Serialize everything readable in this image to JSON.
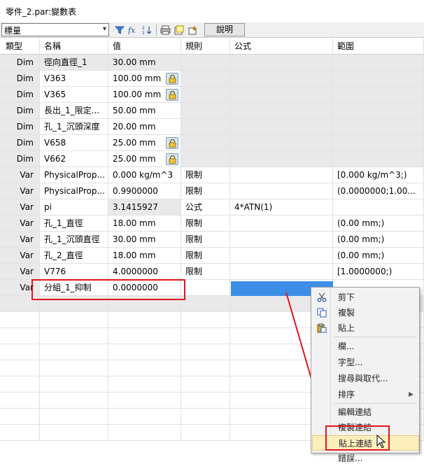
{
  "window": {
    "title": "零件_2.par:變數表"
  },
  "toolbar": {
    "filter_value": "標量",
    "help_label": "說明",
    "icons": [
      "filter-icon",
      "fx-icon",
      "sort-icon",
      "print-icon",
      "export-icon",
      "import-icon"
    ]
  },
  "table": {
    "headers": {
      "type": "類型",
      "name": "名稱",
      "value": "值",
      "rule": "規則",
      "formula": "公式",
      "range": "範圍"
    },
    "rows": [
      {
        "type": "Dim",
        "name": "徑向直徑_1",
        "value": "30.00 mm",
        "rule": "",
        "formula": "",
        "range": "",
        "lock": false
      },
      {
        "type": "Dim",
        "name": "V363",
        "value": "100.00 mm",
        "rule": "",
        "formula": "",
        "range": "",
        "lock": true
      },
      {
        "type": "Dim",
        "name": "V365",
        "value": "100.00 mm",
        "rule": "",
        "formula": "",
        "range": "",
        "lock": true
      },
      {
        "type": "Dim",
        "name": "長出_1_限定...",
        "value": "50.00 mm",
        "rule": "",
        "formula": "",
        "range": "",
        "lock": false
      },
      {
        "type": "Dim",
        "name": "孔_1_沉頭深度",
        "value": "20.00 mm",
        "rule": "",
        "formula": "",
        "range": "",
        "lock": false
      },
      {
        "type": "Dim",
        "name": "V658",
        "value": "25.00 mm",
        "rule": "",
        "formula": "",
        "range": "",
        "lock": true
      },
      {
        "type": "Dim",
        "name": "V662",
        "value": "25.00 mm",
        "rule": "",
        "formula": "",
        "range": "",
        "lock": true
      },
      {
        "type": "Var",
        "name": "PhysicalProp...",
        "value": "0.000 kg/m^3",
        "rule": "限制",
        "formula": "",
        "range": "[0.000 kg/m^3;)",
        "lock": false
      },
      {
        "type": "Var",
        "name": "PhysicalProp...",
        "value": "0.9900000",
        "rule": "限制",
        "formula": "",
        "range": "(0.0000000;1.00...",
        "lock": false
      },
      {
        "type": "Var",
        "name": "pi",
        "value": "3.1415927",
        "rule": "公式",
        "formula": "4*ATN(1)",
        "range": "",
        "lock": false
      },
      {
        "type": "Var",
        "name": "孔_1_直徑",
        "value": "18.00 mm",
        "rule": "限制",
        "formula": "",
        "range": "(0.00 mm;)",
        "lock": false
      },
      {
        "type": "Var",
        "name": "孔_1_沉頭直徑",
        "value": "30.00 mm",
        "rule": "限制",
        "formula": "",
        "range": "(0.00 mm;)",
        "lock": false
      },
      {
        "type": "Var",
        "name": "孔_2_直徑",
        "value": "18.00 mm",
        "rule": "限制",
        "formula": "",
        "range": "(0.00 mm;)",
        "lock": false
      },
      {
        "type": "Var",
        "name": "V776",
        "value": "4.0000000",
        "rule": "限制",
        "formula": "",
        "range": "[1.0000000;)",
        "lock": false
      },
      {
        "type": "Var",
        "name": "分組_1_抑制",
        "value": "0.0000000",
        "rule": "",
        "formula": "",
        "range": "",
        "lock": false
      }
    ]
  },
  "context_menu": {
    "items": [
      {
        "label": "剪下",
        "icon": "scissors-icon"
      },
      {
        "label": "複製",
        "icon": "copy-icon"
      },
      {
        "label": "貼上",
        "icon": "paste-icon"
      },
      {
        "label": "欄...",
        "icon": ""
      },
      {
        "label": "字型...",
        "icon": ""
      },
      {
        "label": "搜尋與取代...",
        "icon": ""
      },
      {
        "label": "排序",
        "icon": "",
        "submenu": "▶"
      },
      {
        "label": "編輯連結",
        "icon": ""
      },
      {
        "label": "複製連結",
        "icon": ""
      },
      {
        "label": "貼上連結",
        "icon": ""
      },
      {
        "label": "錯誤...",
        "icon": ""
      }
    ]
  },
  "colors": {
    "accent_red": "#e0161b",
    "selection_blue": "#3d8ee6",
    "menu_hover": "#fcefbd"
  }
}
